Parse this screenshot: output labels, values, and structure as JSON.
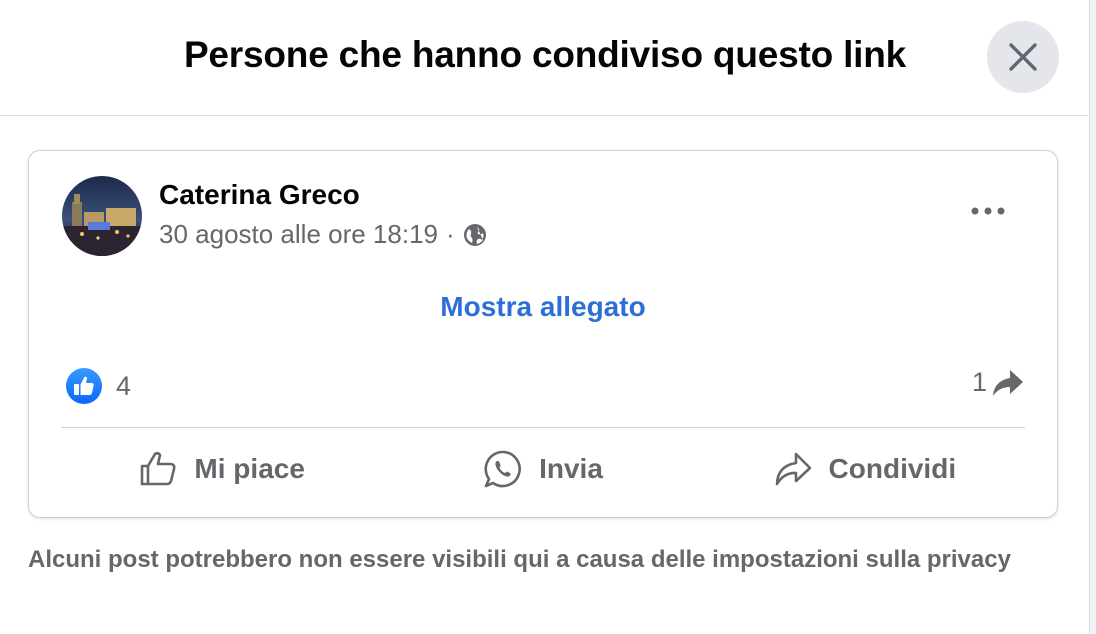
{
  "dialog": {
    "title": "Persone che hanno condiviso questo link",
    "close_icon": "close-icon"
  },
  "post": {
    "author": "Caterina Greco",
    "timestamp": "30 agosto alle ore 18:19",
    "separator": "·",
    "audience_icon": "globe-icon",
    "more_icon": "more-options-icon",
    "attachment_link": "Mostra allegato",
    "reactions": {
      "icon": "like-reaction-icon",
      "count": "4"
    },
    "shares": {
      "count": "1",
      "icon": "share-arrow-icon"
    },
    "actions": [
      {
        "label": "Mi piace",
        "icon": "like-icon"
      },
      {
        "label": "Invia",
        "icon": "whatsapp-icon"
      },
      {
        "label": "Condividi",
        "icon": "share-icon"
      }
    ]
  },
  "footer": {
    "privacy_note": "Alcuni post potrebbero non essere visibili qui a causa delle impostazioni sulla privacy"
  },
  "colors": {
    "link_blue": "#2d6fd6",
    "like_blue": "#1877f2",
    "secondary_text": "#65676b",
    "close_bg": "#e4e6eb"
  }
}
